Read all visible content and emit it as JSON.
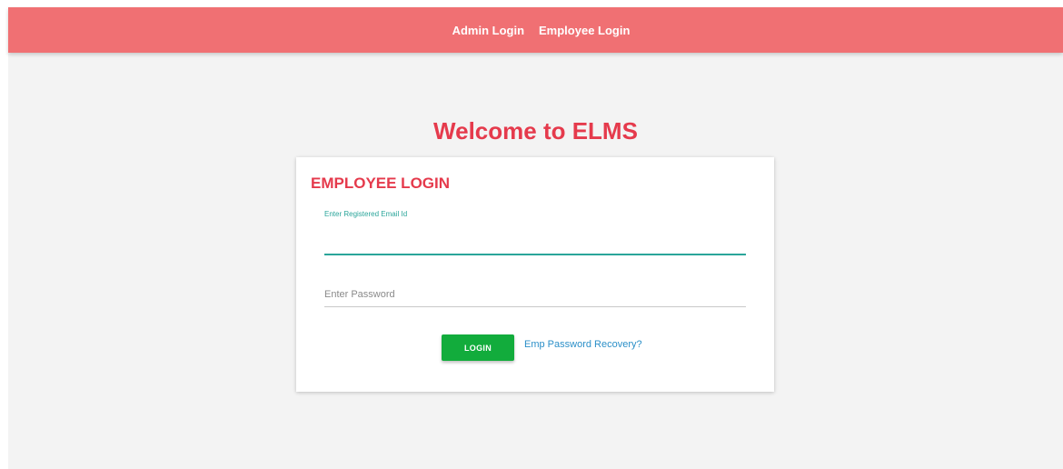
{
  "navbar": {
    "links": [
      "Admin Login",
      "Employee Login"
    ]
  },
  "welcome_title": "Welcome to ELMS",
  "login_card": {
    "title": "EMPLOYEE LOGIN",
    "email_field": {
      "label": "Enter Registered Email Id",
      "value": ""
    },
    "password_field": {
      "placeholder": "Enter Password",
      "value": ""
    },
    "login_button": "LOGIN",
    "recovery_link": "Emp Password Recovery?"
  },
  "colors": {
    "navbar_bg": "#f07073",
    "accent_red": "#e53a4c",
    "teal_focus": "#2aa59a",
    "login_green": "#12ac3c",
    "link_blue": "#2b8fc8",
    "page_bg": "#f3f3f3"
  }
}
